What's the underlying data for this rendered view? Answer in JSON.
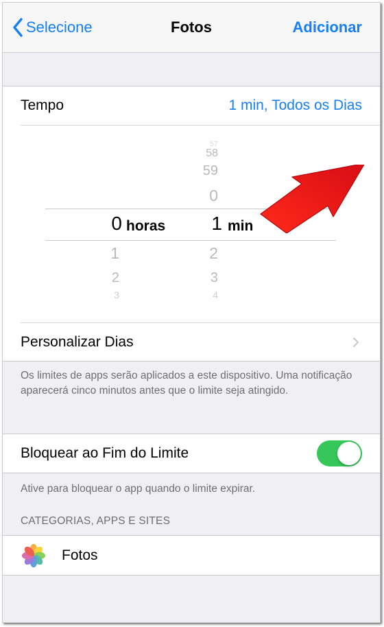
{
  "nav": {
    "back_label": "Selecione",
    "title": "Fotos",
    "add_label": "Adicionar"
  },
  "tempo": {
    "label": "Tempo",
    "value": "1 min, Todos os Dias"
  },
  "picker": {
    "hours": {
      "above": [],
      "selected": "0",
      "below": [
        "1",
        "2",
        "3"
      ],
      "unit": "horas"
    },
    "minutes": {
      "above": [
        "57",
        "58",
        "59",
        "0"
      ],
      "selected": "1",
      "below": [
        "2",
        "3",
        "4"
      ],
      "unit": "min"
    }
  },
  "customize_days": {
    "label": "Personalizar Dias"
  },
  "limits_note": "Os limites de apps serão aplicados a este dispositivo. Uma notificação aparecerá cinco minutos antes que o limite seja atingido.",
  "block": {
    "label": "Bloquear ao Fim do Limite",
    "enabled": true,
    "note": "Ative para bloquear o app quando o limite expirar."
  },
  "categories": {
    "header": "CATEGORIAS, APPS E SITES",
    "items": [
      {
        "name": "Fotos",
        "icon": "photos-app-icon"
      }
    ]
  },
  "colors": {
    "accent": "#147efb",
    "toggle_on": "#35c759",
    "background": "#efeff4",
    "annotation_arrow": "#e8141b"
  }
}
